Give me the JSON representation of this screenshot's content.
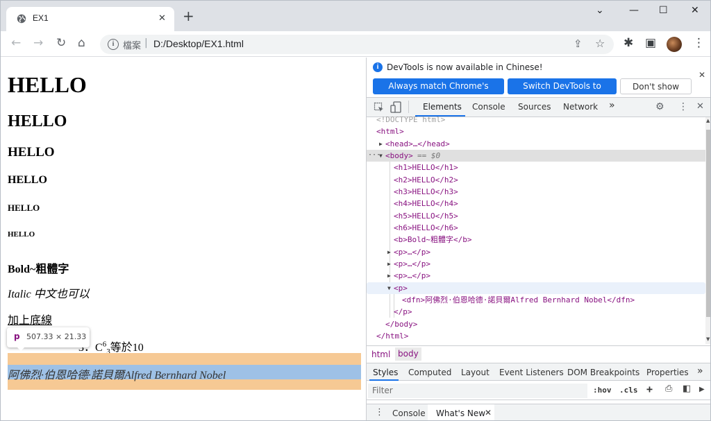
{
  "browser": {
    "tab_title": "EX1",
    "tab_close": "✕",
    "new_tab": "+",
    "window_controls": {
      "minimize": "—",
      "maximize": "☐",
      "close": "✕",
      "tabs_menu": "⌄"
    },
    "nav": {
      "back": "←",
      "forward": "→",
      "reload": "↻",
      "home": "⌂"
    },
    "omnibox": {
      "scheme_label": "檔案",
      "separator": "|",
      "url": "D:/Desktop/EX1.html",
      "share": "⇪",
      "star": "☆"
    },
    "toolbar_icons": {
      "extensions": "✱",
      "sidepanel": "▣",
      "menu": "⋮"
    }
  },
  "page": {
    "h1": "HELLO",
    "h2": "HELLO",
    "h3": "HELLO",
    "h4": "HELLO",
    "h5": "HELLO",
    "h6": "HELLO",
    "bold": "Bold~粗體字",
    "italic": "Italic 中文也可以",
    "underline": "加上底線",
    "formula_tail": "3．C",
    "formula_sup": "6",
    "formula_sub": "3",
    "formula_end": "等於10",
    "dfn": "阿佛烈·伯恩哈德·諾貝爾Alfred Bernhard Nobel",
    "tooltip": {
      "tag": "p",
      "dims": "507.33 × 21.33"
    }
  },
  "devtools": {
    "infobar": {
      "message": "DevTools is now available in Chinese!",
      "buttons": [
        "Always match Chrome's language",
        "Switch DevTools to Chinese",
        "Don't show again"
      ],
      "close": "✕"
    },
    "tabs": [
      "Elements",
      "Console",
      "Sources",
      "Network"
    ],
    "more_tabs": "»",
    "dom": [
      {
        "t": "comment",
        "text": "<!DOCTYPE html>"
      },
      {
        "t": "tag",
        "text": "<html>"
      },
      {
        "t": "tag",
        "text": "<head>…</head>"
      },
      {
        "t": "tag",
        "text": "<body>"
      },
      {
        "t": "tag",
        "text": "<h1>HELLO</h1>"
      },
      {
        "t": "tag",
        "text": "<h2>HELLO</h2>"
      },
      {
        "t": "tag",
        "text": "<h3>HELLO</h3>"
      },
      {
        "t": "tag",
        "text": "<h4>HELLO</h4>"
      },
      {
        "t": "tag",
        "text": "<h5>HELLO</h5>"
      },
      {
        "t": "tag",
        "text": "<h6>HELLO</h6>"
      },
      {
        "t": "tag",
        "text": "<b>Bold~粗體字</b>"
      },
      {
        "t": "tag",
        "text": "<p>…</p>"
      },
      {
        "t": "tag",
        "text": "<p>…</p>"
      },
      {
        "t": "tag",
        "text": "<p>…</p>"
      },
      {
        "t": "tag",
        "text": "<p>"
      },
      {
        "t": "tag",
        "text": "<dfn>阿佛烈·伯恩哈德·諾貝爾Alfred Bernhard Nobel</dfn>"
      },
      {
        "t": "tag",
        "text": "</p>"
      },
      {
        "t": "tag",
        "text": "</body>"
      },
      {
        "t": "tag",
        "text": "</html>"
      }
    ],
    "body_marker": "== $0",
    "row_dots": "···",
    "breadcrumbs": [
      "html",
      "body"
    ],
    "styles_tabs": [
      "Styles",
      "Computed",
      "Layout",
      "Event Listeners",
      "DOM Breakpoints",
      "Properties",
      "»"
    ],
    "filter_placeholder": "Filter",
    "filter_buttons": [
      ":hov",
      ".cls",
      "+"
    ],
    "drawer_tabs": [
      "Console",
      "What's New"
    ],
    "drawer_close": "✕"
  }
}
